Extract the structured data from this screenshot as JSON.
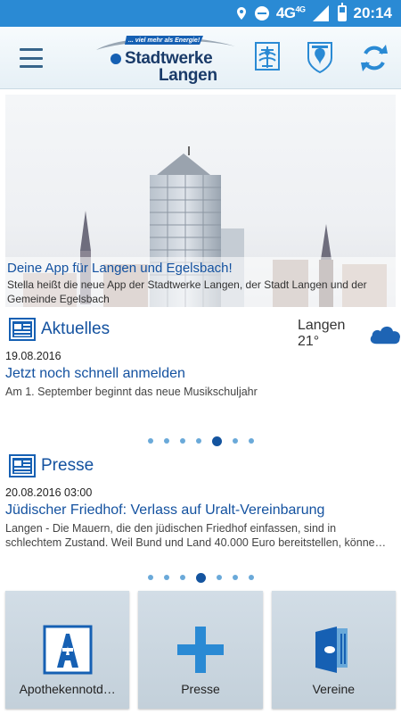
{
  "statusbar": {
    "network": "4G",
    "network_sup": "4G",
    "time": "20:14",
    "icons": [
      "location-icon",
      "dnd-icon",
      "signal-icon",
      "battery-icon"
    ]
  },
  "header": {
    "logo_tagline": "... viel mehr als Energie!",
    "logo_line1": "Stadtwerke",
    "logo_line2": "Langen",
    "icons": [
      "menu-icon",
      "crest-langen-icon",
      "crest-egelsbach-icon",
      "refresh-icon"
    ]
  },
  "hero": {
    "title": "Deine App für Langen und Egelsbach!",
    "text": "Stella heißt die neue App der Stadtwerke Langen, der Stadt Langen und der Gemeinde Egelsbach"
  },
  "aktuelles": {
    "title": "Aktuelles",
    "date": "19.08.2016",
    "headline": "Jetzt noch schnell anmelden",
    "teaser": "Am 1. September beginnt das neue Musikschuljahr",
    "dots_total": 7,
    "dots_active": 4
  },
  "weather": {
    "text": "Langen 21°",
    "icon": "cloud-icon"
  },
  "presse": {
    "title": "Presse",
    "date": "20.08.2016 03:00",
    "headline": "Jüdischer Friedhof: Verlass auf Uralt-Vereinbarung",
    "teaser": "Langen - Die Mauern, die den jüdischen Friedhof einfassen, sind in schlechtem Zustand. Weil Bund und Land 40.000 Euro bereitstellen, könne…",
    "dots_total": 7,
    "dots_active": 3
  },
  "tiles": [
    {
      "label": "Apothekennotd…",
      "icon": "pharmacy-icon"
    },
    {
      "label": "Presse",
      "icon": "plus-icon"
    },
    {
      "label": "Vereine",
      "icon": "door-icon"
    }
  ],
  "colors": {
    "statusbar": "#2a8ad4",
    "accent": "#1452a0",
    "dot": "#6aa9d9"
  }
}
